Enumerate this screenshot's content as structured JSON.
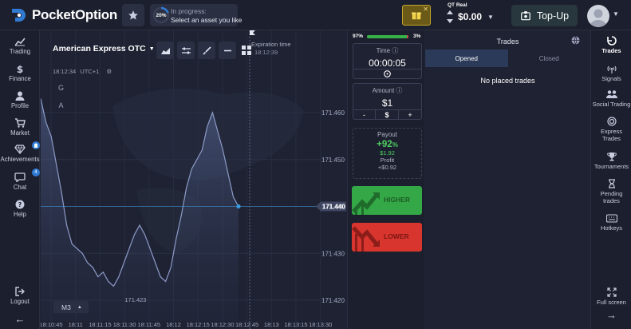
{
  "header": {
    "brand": "PocketOption",
    "progress": {
      "percent": "20%",
      "label": "In progress:",
      "sub": "Select an asset you like"
    },
    "account": {
      "type": "QT Real",
      "balance": "$0.00"
    },
    "topup_label": "Top-Up"
  },
  "left_nav": {
    "items": [
      {
        "label": "Trading",
        "icon": "trading-chart-icon"
      },
      {
        "label": "Finance",
        "icon": "dollar-icon"
      },
      {
        "label": "Profile",
        "icon": "user-icon"
      },
      {
        "label": "Market",
        "icon": "cart-icon"
      },
      {
        "label": "Achievements",
        "icon": "diamond-icon",
        "badge": ""
      },
      {
        "label": "Chat",
        "icon": "chat-icon",
        "badge": "4"
      },
      {
        "label": "Help",
        "icon": "help-icon"
      }
    ],
    "logout": "Logout"
  },
  "chart": {
    "asset": "American Express OTC",
    "time": "18:12:34",
    "timezone": "UTC+1",
    "letters": [
      "G",
      "A"
    ],
    "expiration_label": "Expiration time",
    "expiration_time": "18:12:39",
    "timeframe": "M3",
    "min_label": "171.423",
    "current_price": "171.440"
  },
  "chart_data": {
    "type": "area",
    "title": "",
    "xlabel": "",
    "ylabel": "",
    "ylim": [
      171.415,
      171.465
    ],
    "y_ticks": [
      171.46,
      171.45,
      171.44,
      171.43,
      171.42
    ],
    "y_tick_labels": [
      "171.460",
      "171.450",
      "171.440",
      "171.430",
      "171.420"
    ],
    "x_tick_labels": [
      "18:10:45",
      "18:11",
      "18:11:15",
      "18:11:30",
      "18:11:45",
      "18:12",
      "18:12:15",
      "18:12:30",
      "18:12:45",
      "18:13",
      "18:13:15",
      "18:13:30"
    ],
    "series": [
      {
        "values": [
          171.463,
          171.458,
          171.455,
          171.449,
          171.443,
          171.436,
          171.432,
          171.431,
          171.43,
          171.428,
          171.427,
          171.425,
          171.426,
          171.424,
          171.423,
          171.425,
          171.428,
          171.431,
          171.434,
          171.436,
          171.434,
          171.431,
          171.428,
          171.425,
          171.424,
          171.427,
          171.433,
          171.438,
          171.444,
          171.448,
          171.45,
          171.452,
          171.457,
          171.46,
          171.456,
          171.452,
          171.447,
          171.442,
          171.44
        ]
      }
    ]
  },
  "trade": {
    "sentiment_left": "97%",
    "sentiment_right": "3%",
    "sentiment_fill": 0.97,
    "time_label": "Time",
    "time_value": "00:00:05",
    "amount_label": "Amount",
    "amount_value": "$1",
    "minus": "-",
    "currency": "$",
    "plus": "+",
    "payout_label": "Payout",
    "payout_pct": "+92",
    "payout_pct_unit": "%",
    "payout_amount": "$1.92",
    "profit_label": "Profit",
    "profit_amount": "+$0.92",
    "higher": "HIGHER",
    "lower": "LOWER"
  },
  "trades": {
    "title": "Trades",
    "tabs": [
      "Opened",
      "Closed"
    ],
    "empty": "No placed trades"
  },
  "right_nav": {
    "items": [
      {
        "label": "Trades",
        "icon": "trades-icon"
      },
      {
        "label": "Signals",
        "icon": "signals-icon"
      },
      {
        "label": "Social Trading",
        "icon": "social-icon"
      },
      {
        "label": "Express Trades",
        "icon": "express-icon"
      },
      {
        "label": "Tournaments",
        "icon": "trophy-icon"
      },
      {
        "label": "Pending trades",
        "icon": "hourglass-icon"
      },
      {
        "label": "Hotkeys",
        "icon": "keyboard-icon"
      }
    ],
    "fullscreen": "Full screen"
  },
  "colors": {
    "higher": "#34a746",
    "lower": "#d8352f",
    "accent": "#2f7bd3",
    "price_line": "#3a9be0"
  }
}
